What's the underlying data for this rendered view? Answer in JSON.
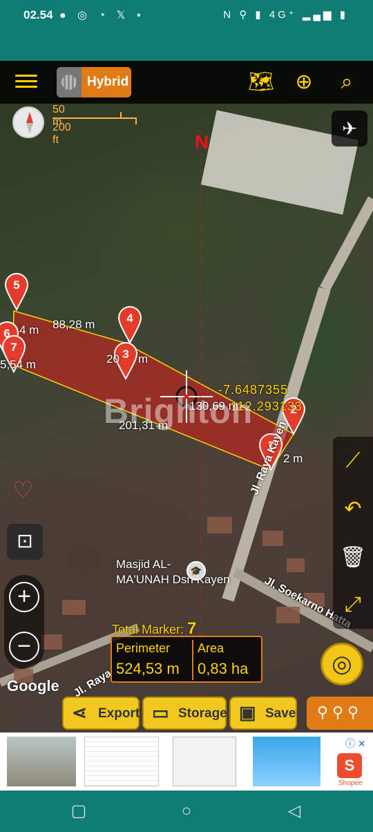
{
  "status_bar": {
    "time": "02.54",
    "left_icons": "● ◎ ◔ 𝕏 •",
    "right_icons": "N ⚲ ▮ 4G⁺ ▂▄▆ ▮"
  },
  "toolbar": {
    "map_type_label": "Hybrid",
    "menu_icon": "menu-icon",
    "map_icon": "map-layers-icon",
    "pin_icon": "location-globe-icon",
    "search_icon": "search-icon"
  },
  "scale": {
    "metric": "50 m",
    "imperial": "200 ft"
  },
  "compass_north": "N",
  "polygon": {
    "fill_color": "#c8241e",
    "markers": [
      {
        "num": "1"
      },
      {
        "num": "2"
      },
      {
        "num": "3"
      },
      {
        "num": "4"
      },
      {
        "num": "5"
      },
      {
        "num": "6"
      },
      {
        "num": "7"
      }
    ],
    "edge_labels": {
      "top": "88,28 m",
      "left_top": "4 m",
      "left_side": "5,54 m",
      "mid": "20",
      "mid_suffix": "m",
      "center": "130,69 m",
      "bottom": "201,31 m",
      "right": "2 m"
    }
  },
  "crosshair": {
    "lat": "-7.6487355",
    "lon": "112.293133"
  },
  "watermark": "Brighton",
  "poi": {
    "name_line1": "Masjid AL-",
    "name_line2": "MA'UNAH Dsn Kayen"
  },
  "roads": {
    "raya_kayen": "Jl. Raya Kayen",
    "soekarno": "Jl. Soekarno Hatta",
    "raya_bottom": "Jl. Raya"
  },
  "google_logo": "Google",
  "summary": {
    "total_marker_label": "Total Marker:",
    "total_marker_value": "7",
    "perimeter_label": "Perimeter",
    "perimeter_value": "524,53 m",
    "area_label": "Area",
    "area_value": "0,83 ha"
  },
  "actions": {
    "export": "Export",
    "storage": "Storage",
    "save": "Save"
  },
  "ad": {
    "shopee_label": "Shopee"
  }
}
